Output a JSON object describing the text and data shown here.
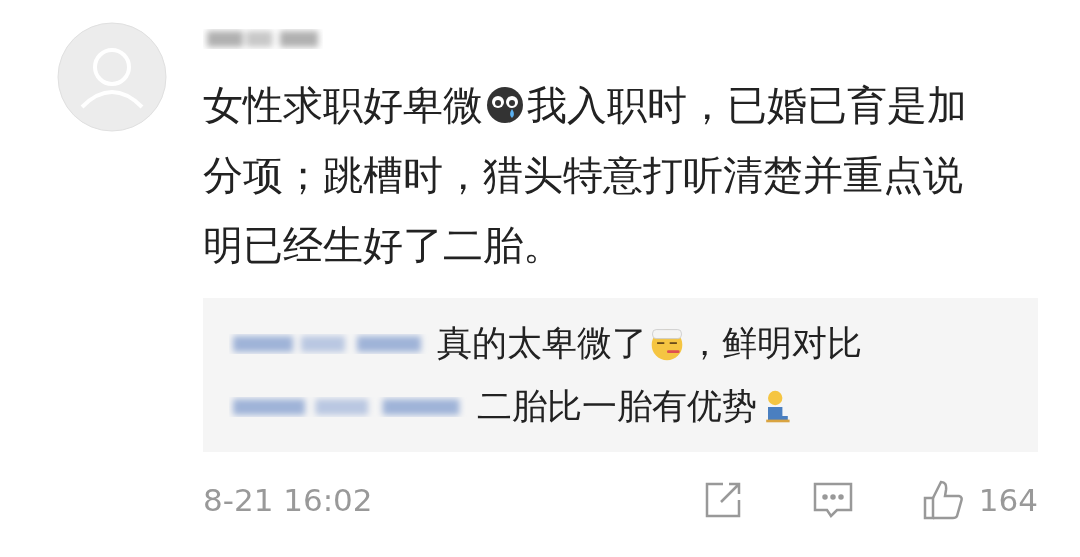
{
  "comment": {
    "lines": [
      [
        {
          "kind": "text",
          "text": "女性求职好卑微"
        },
        {
          "kind": "crying"
        },
        {
          "kind": "text",
          "text": "我入职时，已婚已育是加"
        }
      ],
      [
        {
          "kind": "text",
          "text": "分项；跳槽时，猎头特意打听清楚并重点说"
        }
      ],
      [
        {
          "kind": "text",
          "text": "明已经生好了二胎。"
        }
      ]
    ]
  },
  "replies": [
    {
      "segments": [
        {
          "kind": "text",
          "text": "真的太卑微了"
        },
        {
          "kind": "sick"
        },
        {
          "kind": "text",
          "text": "，鲜明对比"
        }
      ]
    },
    {
      "segments": [
        {
          "kind": "text",
          "text": "二胎比一胎有优势"
        },
        {
          "kind": "kneeling"
        }
      ]
    }
  ],
  "footer": {
    "time": "8-21 16:02",
    "likes": "164"
  }
}
